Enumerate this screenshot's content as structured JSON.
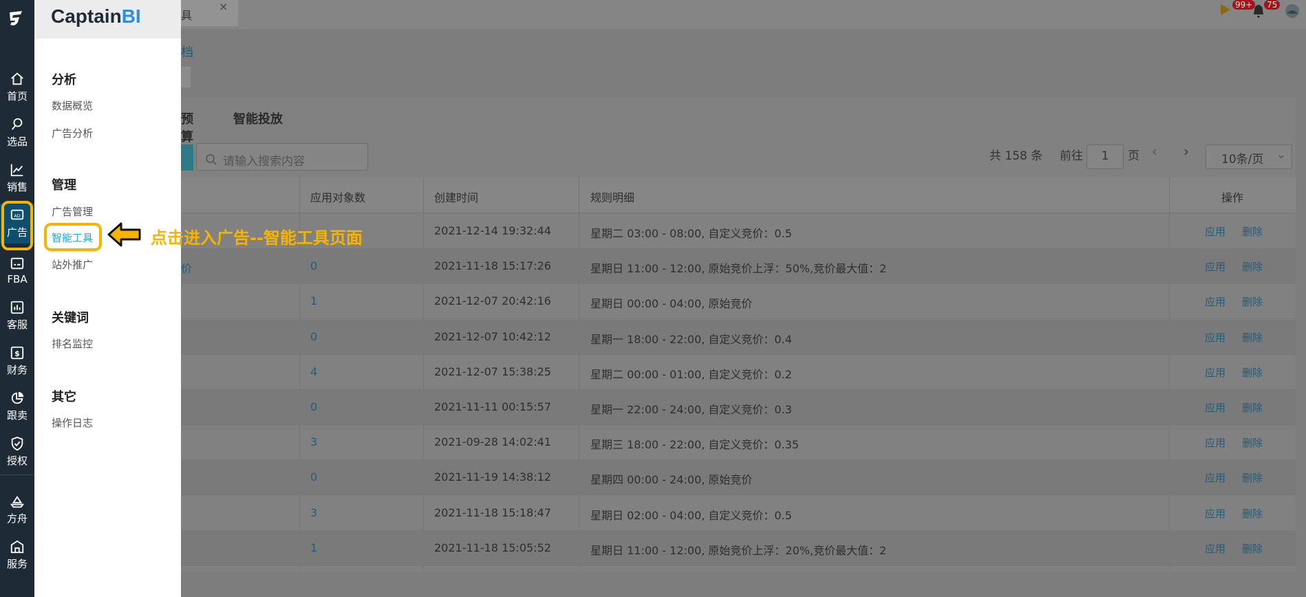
{
  "rail": {
    "items": [
      {
        "label": "首页",
        "icon": "home-icon"
      },
      {
        "label": "选品",
        "icon": "search-icon"
      },
      {
        "label": "销售",
        "icon": "chart-line-icon"
      },
      {
        "label": "广告",
        "icon": "ad-icon"
      },
      {
        "label": "FBA",
        "icon": "fba-icon"
      },
      {
        "label": "客服",
        "icon": "bar-chart-icon"
      },
      {
        "label": "财务",
        "icon": "dollar-icon"
      },
      {
        "label": "跟卖",
        "icon": "pie-chart-icon"
      },
      {
        "label": "授权",
        "icon": "shield-check-icon"
      },
      {
        "label": "方舟",
        "icon": "ark-icon"
      },
      {
        "label": "服务",
        "icon": "service-icon"
      }
    ]
  },
  "panel": {
    "brand_main": "Captain",
    "brand_accent": "BI",
    "groups": [
      {
        "title": "分析",
        "items": [
          "数据概览",
          "广告分析"
        ]
      },
      {
        "title": "管理",
        "items": [
          "广告管理",
          "智能工具",
          "站外推广"
        ]
      },
      {
        "title": "关键词",
        "items": [
          "排名监控"
        ]
      },
      {
        "title": "其它",
        "items": [
          "操作日志"
        ]
      }
    ],
    "active_item": "智能工具"
  },
  "annotation": {
    "callout": "点击进入广告--智能工具页面"
  },
  "app": {
    "tab_label": "具",
    "tab_close": "×",
    "breadcrumb": "档",
    "subtabs": [
      "预算",
      "智能投放"
    ],
    "search_placeholder": "请输入搜索内容",
    "pager": {
      "total": "共 158 条",
      "goto": "前往",
      "page": "1",
      "page_unit": "页",
      "prev": "‹",
      "next": "›",
      "page_size": "10条/页",
      "page_size_caret": "⌄"
    },
    "top": {
      "badge1": "99+",
      "badge2": "75"
    },
    "table": {
      "headers": [
        "应用对象数",
        "创建时间",
        "规则明细",
        "操作"
      ],
      "rows": [
        {
          "name": "",
          "count": "",
          "created": "2021-12-14 19:32:44",
          "rule": "星期二 03:00 - 08:00, 自定义竞价：0.5"
        },
        {
          "name": "价",
          "count": "0",
          "created": "2021-11-18 15:17:26",
          "rule": "星期日 11:00 - 12:00, 原始竞价上浮：50%,竞价最大值：2"
        },
        {
          "name": "",
          "count": "1",
          "created": "2021-12-07 20:42:16",
          "rule": "星期日 00:00 - 04:00, 原始竞价"
        },
        {
          "name": "",
          "count": "0",
          "created": "2021-12-07 10:42:12",
          "rule": "星期一 18:00 - 22:00, 自定义竞价：0.4"
        },
        {
          "name": "",
          "count": "4",
          "created": "2021-12-07 15:38:25",
          "rule": "星期二 00:00 - 01:00, 自定义竞价：0.2"
        },
        {
          "name": "",
          "count": "0",
          "created": "2021-11-11 00:15:57",
          "rule": "星期一 22:00 - 24:00, 自定义竞价：0.3"
        },
        {
          "name": "",
          "count": "3",
          "created": "2021-09-28 14:02:41",
          "rule": "星期三 18:00 - 22:00, 自定义竞价：0.35"
        },
        {
          "name": "",
          "count": "0",
          "created": "2021-11-19 14:38:12",
          "rule": "星期四 00:00 - 24:00, 原始竞价"
        },
        {
          "name": "",
          "count": "3",
          "created": "2021-11-18 15:18:47",
          "rule": "星期日 02:00 - 04:00, 自定义竞价：0.5"
        },
        {
          "name": "",
          "count": "1",
          "created": "2021-11-18 15:05:52",
          "rule": "星期日 11:00 - 12:00, 原始竞价上浮：20%,竞价最大值：2"
        }
      ],
      "action_apply": "应用",
      "action_delete": "删除"
    }
  },
  "colors": {
    "accent": "#2ba5c7",
    "highlight": "#f6b300",
    "rail": "#1e2a36"
  }
}
